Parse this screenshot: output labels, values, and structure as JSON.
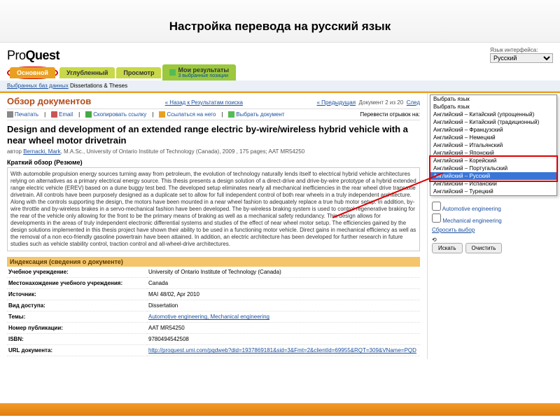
{
  "slide": {
    "title": "Настройка перевода на русский язык"
  },
  "header": {
    "logo_pre": "Pro",
    "logo_bold": "Quest",
    "lang_label": "Язык интерфейса:",
    "lang_value": "Русский"
  },
  "tabs": {
    "main": "Основной",
    "advanced": "Углубленный",
    "browse": "Просмотр",
    "results": "Мои результаты",
    "results_sub": "3 выбранные позиции"
  },
  "dbline": {
    "db_link": "Выбранных баз данных",
    "db_text": "Dissertations & Theses"
  },
  "doc": {
    "overview": "Обзор документов",
    "back": "« Назад к Результатам поиска",
    "prevnext_prev": "« Предыдущая",
    "prevnext_pos": "Документ 2 из 20",
    "prevnext_next": "След"
  },
  "toolbar": {
    "print": "Печатать",
    "email": "Email",
    "copy": "Скопировать ссылку",
    "cite": "Ссылаться на него",
    "select": "Выбрать документ",
    "translate_label": "Перевести отрывок на:"
  },
  "article": {
    "title": "Design and development of an extended range electric by-wire/wireless hybrid vehicle with a near wheel motor drivetrain",
    "meta_prefix": "автор ",
    "author": "Bernacki, Mark",
    "meta_tail": ", M.A.Sc., University of Ontario Institute of Technology (Canada), 2009 , 175 pages; AAT MR54250",
    "abs_hdr": "Краткий обзор (Резюме)",
    "abstract": "With automobile propulsion energy sources turning away from petroleum, the evolution of technology naturally lends itself to electrical hybrid vehicle architectures relying on alternatives as a primary electrical energy source. This thesis presents a design solution of a direct-drive and drive-by-wire prototype of a hybrid extended range electric vehicle (EREV) based on a dune buggy test bed. The developed setup eliminates nearly all mechanical inefficiencies in the rear wheel drive transaxle drivetrain. All controls have been purposely designed as a duplicate set to allow for full independent control of both rear wheels in a truly independent architecture. Along with the controls supporting the design, the motors have been mounted in a near wheel fashion to adequately replace a true hub motor setup. In addition, by-wire throttle and by-wireless brakes in a servo-mechanical fashion have been developed. The by-wireless braking system is used to control regenerative braking for the rear of the vehicle only allowing for the front to be the primary means of braking as well as a mechanical safety redundancy. This design allows for developments in the areas of truly independent electronic differential systems and studies of the effect of near wheel motor setup. The efficiencies gained by the design solutions implemented in this thesis project have shown their ability to be used in a functioning motor vehicle. Direct gains in mechanical efficiency as well as the removal of a non eco-friendly gasoline powertrain have been attained. In addition, an electric architecture has been developed for further research in future studies such as vehicle stability control, traction control and all-wheel-drive architectures."
  },
  "index": {
    "header": "Индексация (сведения о документе)",
    "rows": [
      {
        "k": "Учебное учреждение:",
        "v": "University of Ontario Institute of Technology (Canada)"
      },
      {
        "k": "Местонахождение учебного учреждения:",
        "v": "Canada"
      },
      {
        "k": "Источник:",
        "v": "MAI 48/02, Apr 2010"
      },
      {
        "k": "Вид доступа:",
        "v": "Dissertation"
      },
      {
        "k": "Темы:",
        "v": "Automotive engineering, Mechanical engineering",
        "linked": true
      },
      {
        "k": "Номер публикации:",
        "v": "AAT MR54250"
      },
      {
        "k": "ISBN:",
        "v": "9780494542508"
      },
      {
        "k": "URL документа:",
        "v": "http://proquest.umi.com/pqdweb?did=1937869181&sid=3&Fmt=2&clientId=69955&RQT=309&VName=PQD",
        "linked": true
      }
    ]
  },
  "lang_dropdown": {
    "options": [
      "Выбрать язык",
      "Выбрать язык",
      "Английский – Китайский (упрощенный)",
      "Английский – Китайский (традиционный)",
      "Английский – Французский",
      "Английский – Немецкий",
      "Английский – Итальянский",
      "Английский – Японский",
      "Английский – Корейский",
      "Английский – Португальский",
      "Английский – Русский",
      "Английский – Испанский",
      "Английский – Турецкий"
    ],
    "selected_index": 10
  },
  "sidebar": {
    "check1": "Automotive engineering",
    "check2": "Mechanical engineering",
    "reset": "Сбросить выбор",
    "search": "Искать",
    "clear": "Очистить"
  }
}
